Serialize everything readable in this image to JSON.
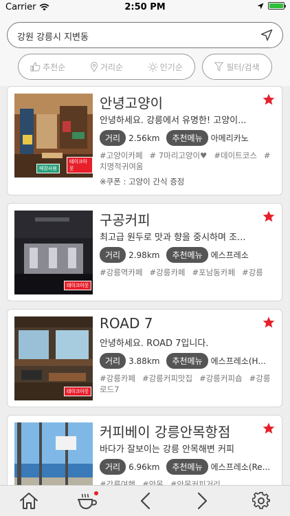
{
  "status_bar": {
    "carrier": "Carrier",
    "time": "2:50 PM"
  },
  "search": {
    "location": "강원 강릉시 지변동"
  },
  "sort_tabs": [
    {
      "label": "추천순",
      "icon": "thumbs-up-icon"
    },
    {
      "label": "거리순",
      "icon": "location-pin-icon"
    },
    {
      "label": "인기순",
      "icon": "sun-icon"
    }
  ],
  "filter": {
    "label": "필터/검색",
    "icon": "filter-icon"
  },
  "labels": {
    "distance": "거리",
    "menu": "추천메뉴"
  },
  "badges": {
    "store": "매장사용",
    "takeout": "테이크아웃"
  },
  "cafes": [
    {
      "name": "안녕고양이",
      "desc": "안녕하세요. 강릉에서 유명한! 고양이...",
      "distance": "2.56km",
      "menu": "아메리카노",
      "tags": [
        "#고양이카페",
        "# 7마리고양이♥",
        "#데이트코스",
        "#치명적귀여움"
      ],
      "coupon": "※쿠폰 : 고양이 간식 증정"
    },
    {
      "name": "구공커피",
      "desc": "최고급 원두로 맛과 향을 중시하며 조...",
      "distance": "2.98km",
      "menu": "에스프레소",
      "tags": [
        "#강릉역카페",
        "#강릉카페",
        "#포남동카페",
        "#강릉"
      ]
    },
    {
      "name": "ROAD 7",
      "desc": "안녕하세요. ROAD 7입니다.",
      "distance": "3.88km",
      "menu": "에스프레소(H...",
      "tags": [
        "#강릉카페",
        "#강릉커피맛집",
        "#강릉커피숍",
        "#강릉로드7"
      ]
    },
    {
      "name": "커피베이 강릉안목항점",
      "desc": "바다가 잘보이는 강릉 안목해변 커피",
      "distance": "6.96km",
      "menu": "에스프레소(Re...",
      "tags": [
        "#강릉여행",
        "#안목",
        "#안목커피거리"
      ]
    }
  ],
  "colors": {
    "star": "#e61f2a",
    "pill": "#555555",
    "notification_dot": "#e61f2a",
    "battery": "#2fbf3a"
  },
  "tab_bar": [
    "home-icon",
    "coffee-cup-icon",
    "back-arrow-icon",
    "forward-arrow-icon",
    "settings-gear-icon"
  ]
}
